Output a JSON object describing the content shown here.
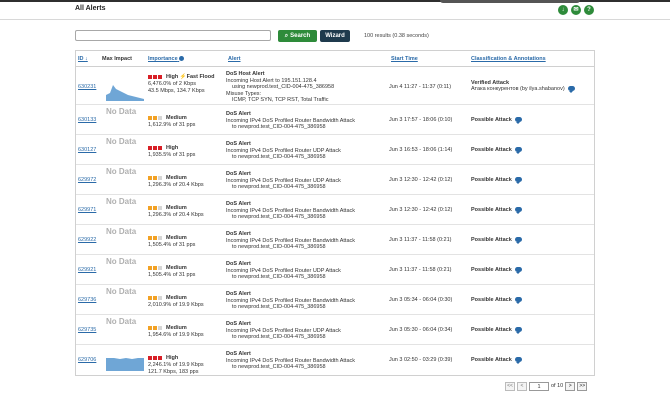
{
  "page": {
    "title": "All Alerts"
  },
  "search": {
    "placeholder": "",
    "search_label": "Search",
    "wizard_label": "Wizard",
    "result_count": "100 results (0.38 seconds)"
  },
  "columns": {
    "id": "ID",
    "max_impact": "Max Impact",
    "importance": "Importance",
    "alert": "Alert",
    "start_time": "Start Time",
    "classification": "Classification & Annotations"
  },
  "nodata_label": "No Data",
  "rows": [
    {
      "id": "630231",
      "impact": "spark",
      "level": "High",
      "squares": [
        "red",
        "red",
        "red"
      ],
      "extra": "Fast Flood",
      "rate": "6,476.0% of 2 Kbps",
      "rate2": "43.5 Mbps, 134.7 Kbps",
      "alert_title": "DoS Host Alert",
      "alert_lines": [
        "Incoming Host Alert to 195.151.128.4",
        "using newprod.test_CID-004-475_386958",
        "Misuse Types:",
        "ICMP, TCP SYN, TCP RST, Total Traffic"
      ],
      "start": "Jun 4 11:27 - 11:37 (0:11)",
      "classification": "Verified Attack",
      "annotation": "Атака конкурентов (by ilya.shabanov)"
    },
    {
      "id": "630133",
      "impact": "nodata",
      "level": "Medium",
      "squares": [
        "orange",
        "orange",
        "gray"
      ],
      "rate": "1,612.9% of 31 pps",
      "alert_title": "DoS Alert",
      "alert_lines": [
        "Incoming IPv4 DoS Profiled Router Bandwidth Attack",
        "to newprod.test_CID-004-475_386958"
      ],
      "start": "Jun 3 17:57 - 18:06 (0:10)",
      "classification": "Possible Attack"
    },
    {
      "id": "630127",
      "impact": "nodata",
      "level": "High",
      "squares": [
        "red",
        "red",
        "red"
      ],
      "rate": "1,935.5% of 31 pps",
      "alert_title": "DoS Alert",
      "alert_lines": [
        "Incoming IPv4 DoS Profiled Router UDP Attack",
        "to newprod.test_CID-004-475_386958"
      ],
      "start": "Jun 3 16:53 - 18:06 (1:14)",
      "classification": "Possible Attack"
    },
    {
      "id": "629972",
      "impact": "nodata",
      "level": "Medium",
      "squares": [
        "orange",
        "orange",
        "gray"
      ],
      "rate": "1,296.3% of 20.4 Kbps",
      "alert_title": "DoS Alert",
      "alert_lines": [
        "Incoming IPv4 DoS Profiled Router UDP Attack",
        "to newprod.test_CID-004-475_386958"
      ],
      "start": "Jun 3 12:30 - 12:42 (0:12)",
      "classification": "Possible Attack"
    },
    {
      "id": "629971",
      "impact": "nodata",
      "level": "Medium",
      "squares": [
        "orange",
        "orange",
        "gray"
      ],
      "rate": "1,296.3% of 20.4 Kbps",
      "alert_title": "DoS Alert",
      "alert_lines": [
        "Incoming IPv4 DoS Profiled Router Bandwidth Attack",
        "to newprod.test_CID-004-475_386958"
      ],
      "start": "Jun 3 12:30 - 12:42 (0:12)",
      "classification": "Possible Attack"
    },
    {
      "id": "629922",
      "impact": "nodata",
      "level": "Medium",
      "squares": [
        "orange",
        "orange",
        "gray"
      ],
      "rate": "1,505.4% of 31 pps",
      "alert_title": "DoS Alert",
      "alert_lines": [
        "Incoming IPv4 DoS Profiled Router Bandwidth Attack",
        "to newprod.test_CID-004-475_386958"
      ],
      "start": "Jun 3 11:37 - 11:58 (0:21)",
      "classification": "Possible Attack"
    },
    {
      "id": "629921",
      "impact": "nodata",
      "level": "Medium",
      "squares": [
        "orange",
        "orange",
        "gray"
      ],
      "rate": "1,505.4% of 31 pps",
      "alert_title": "DoS Alert",
      "alert_lines": [
        "Incoming IPv4 DoS Profiled Router UDP Attack",
        "to newprod.test_CID-004-475_386958"
      ],
      "start": "Jun 3 11:37 - 11:58 (0:21)",
      "classification": "Possible Attack"
    },
    {
      "id": "629736",
      "impact": "nodata",
      "level": "Medium",
      "squares": [
        "orange",
        "orange",
        "gray"
      ],
      "rate": "2,010.9% of 19.9 Kbps",
      "alert_title": "DoS Alert",
      "alert_lines": [
        "Incoming IPv4 DoS Profiled Router Bandwidth Attack",
        "to newprod.test_CID-004-475_386958"
      ],
      "start": "Jun 3 05:34 - 06:04 (0:30)",
      "classification": "Possible Attack"
    },
    {
      "id": "629735",
      "impact": "nodata",
      "level": "Medium",
      "squares": [
        "orange",
        "orange",
        "gray"
      ],
      "rate": "1,954.6% of 19.9 Kbps",
      "alert_title": "DoS Alert",
      "alert_lines": [
        "Incoming IPv4 DoS Profiled Router UDP Attack",
        "to newprod.test_CID-004-475_386958"
      ],
      "start": "Jun 3 05:30 - 06:04 (0:34)",
      "classification": "Possible Attack"
    },
    {
      "id": "629706",
      "impact": "spark",
      "level": "High",
      "squares": [
        "red",
        "red",
        "red"
      ],
      "rate": "2,246.1% of 19.9 Kbps",
      "rate2": "121.7 Kbps, 183 pps",
      "alert_title": "DoS Alert",
      "alert_lines": [
        "Incoming IPv4 DoS Profiled Router Bandwidth Attack",
        "to newprod.test_CID-004-475_386958"
      ],
      "start": "Jun 3 02:50 - 03:29 (0:39)",
      "classification": "Possible Attack"
    }
  ],
  "pager": {
    "first": "<<",
    "prev": "<",
    "page": "1",
    "of": "of 10",
    "next": ">",
    "last": ">>"
  },
  "colors": {
    "accent": "#2e8b3a",
    "link": "#2a6aa8",
    "high": "#d81f26",
    "medium": "#f2a124",
    "wizard": "#1f3a4d"
  }
}
